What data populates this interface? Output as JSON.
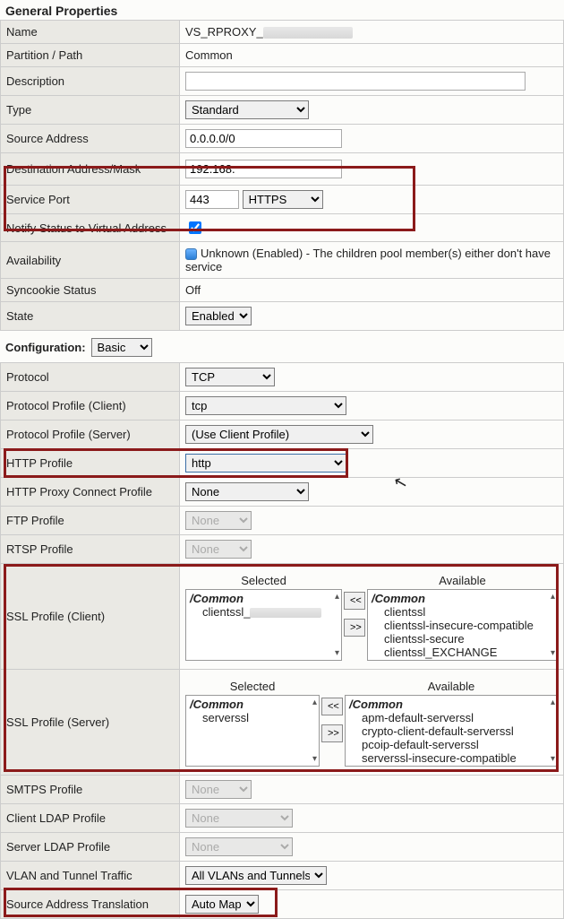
{
  "sections": {
    "general": "General Properties",
    "config": "Configuration:"
  },
  "general": {
    "name_label": "Name",
    "name_value_prefix": "VS_RPROXY_",
    "partition_label": "Partition / Path",
    "partition_value": "Common",
    "description_label": "Description",
    "description_value": "",
    "type_label": "Type",
    "type_value": "Standard",
    "source_label": "Source Address",
    "source_value": "0.0.0.0/0",
    "dest_label": "Destination Address/Mask",
    "dest_value_prefix": "192.168.",
    "port_label": "Service Port",
    "port_num": "443",
    "port_name": "HTTPS",
    "notify_label": "Notify Status to Virtual Address",
    "avail_label": "Availability",
    "avail_value": "Unknown (Enabled) - The children pool member(s) either don't have service",
    "syncookie_label": "Syncookie Status",
    "syncookie_value": "Off",
    "state_label": "State",
    "state_value": "Enabled"
  },
  "config_select": "Basic",
  "config": {
    "protocol_label": "Protocol",
    "protocol_value": "TCP",
    "pp_client_label": "Protocol Profile (Client)",
    "pp_client_value": "tcp",
    "pp_server_label": "Protocol Profile (Server)",
    "pp_server_value": "(Use Client Profile)",
    "http_label": "HTTP Profile",
    "http_value": "http",
    "proxy_label": "HTTP Proxy Connect Profile",
    "proxy_value": "None",
    "ftp_label": "FTP Profile",
    "ftp_value": "None",
    "rtsp_label": "RTSP Profile",
    "rtsp_value": "None",
    "ssl_client_label": "SSL Profile (Client)",
    "ssl_server_label": "SSL Profile (Server)",
    "smtps_label": "SMTPS Profile",
    "smtps_value": "None",
    "cldap_label": "Client LDAP Profile",
    "cldap_value": "None",
    "sldap_label": "Server LDAP Profile",
    "sldap_value": "None",
    "vlan_label": "VLAN and Tunnel Traffic",
    "vlan_value": "All VLANs and Tunnels",
    "snat_label": "Source Address Translation",
    "snat_value": "Auto Map"
  },
  "listbox": {
    "selected_title": "Selected",
    "available_title": "Available",
    "common_group": "/Common",
    "move_left": "<<",
    "move_right": ">>",
    "ssl_client_selected_prefix": "clientssl_",
    "ssl_client_avail": [
      "clientssl",
      "clientssl-insecure-compatible",
      "clientssl-secure",
      "clientssl_EXCHANGE"
    ],
    "ssl_server_selected": [
      "serverssl"
    ],
    "ssl_server_avail": [
      "apm-default-serverssl",
      "crypto-client-default-serverssl",
      "pcoip-default-serverssl",
      "serverssl-insecure-compatible"
    ]
  }
}
